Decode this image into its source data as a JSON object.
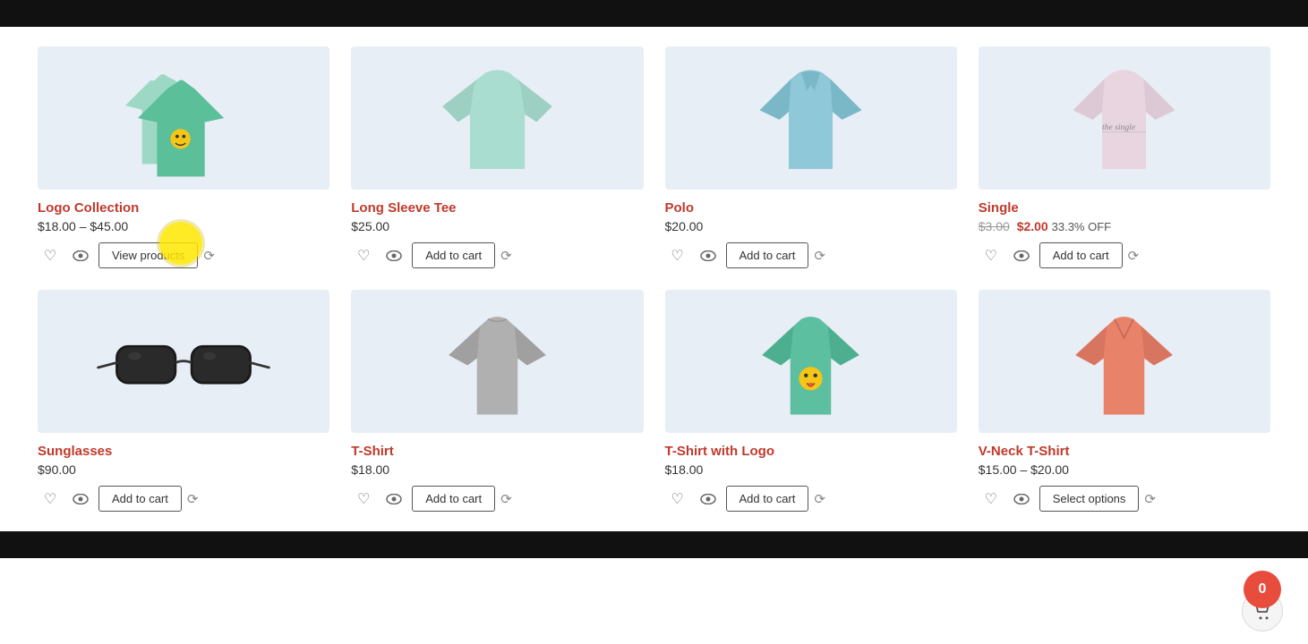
{
  "bars": {
    "top_color": "#111",
    "bottom_color": "#111"
  },
  "products": [
    {
      "id": "logo-collection",
      "name": "Logo Collection",
      "price": "$18.00 – $45.00",
      "price_type": "range",
      "action_label": "View products",
      "row": 0
    },
    {
      "id": "long-sleeve-tee",
      "name": "Long Sleeve Tee",
      "price": "$25.00",
      "price_type": "single",
      "action_label": "Add to cart",
      "row": 0
    },
    {
      "id": "polo",
      "name": "Polo",
      "price": "$20.00",
      "price_type": "single",
      "action_label": "Add to cart",
      "row": 0
    },
    {
      "id": "single",
      "name": "Single",
      "price_original": "$3.00",
      "price_sale": "$2.00",
      "price_badge": "33.3% OFF",
      "price_type": "sale",
      "action_label": "Add to cart",
      "row": 0
    },
    {
      "id": "sunglasses",
      "name": "Sunglasses",
      "price": "$90.00",
      "price_type": "single",
      "action_label": "Add to cart",
      "row": 1
    },
    {
      "id": "t-shirt",
      "name": "T-Shirt",
      "price": "$18.00",
      "price_type": "single",
      "action_label": "Add to cart",
      "row": 1
    },
    {
      "id": "t-shirt-with-logo",
      "name": "T-Shirt with Logo",
      "price": "$18.00",
      "price_type": "single",
      "action_label": "Add to cart",
      "row": 1
    },
    {
      "id": "v-neck-t-shirt",
      "name": "V-Neck T-Shirt",
      "price": "$15.00 – $20.00",
      "price_type": "range",
      "action_label": "Select options",
      "row": 1
    }
  ],
  "cart": {
    "count": "0",
    "label": "cart"
  },
  "buttons": {
    "view_products": "View products",
    "add_to_cart": "Add to cart",
    "select_options": "Select options"
  },
  "icons": {
    "wishlist": "♡",
    "quickview": "👁",
    "compare": "⟳",
    "wishlist_filled": "♡",
    "cart": "🛒"
  }
}
